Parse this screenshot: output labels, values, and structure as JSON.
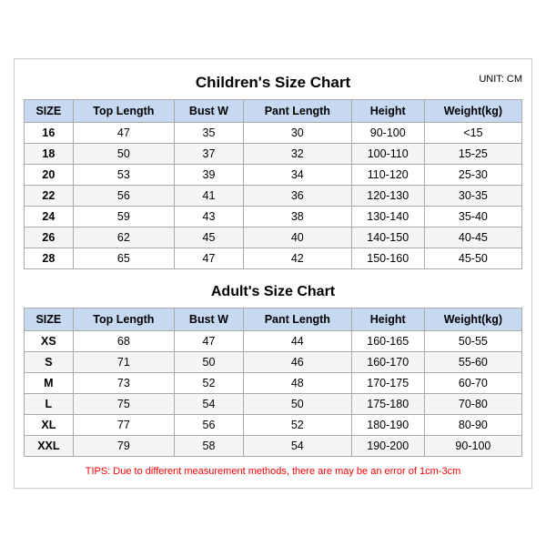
{
  "page": {
    "main_title": "Children's Size Chart",
    "unit_label": "UNIT: CM",
    "children_headers": [
      "SIZE",
      "Top Length",
      "Bust W",
      "Pant Length",
      "Height",
      "Weight(kg)"
    ],
    "children_rows": [
      [
        "16",
        "47",
        "35",
        "30",
        "90-100",
        "<15"
      ],
      [
        "18",
        "50",
        "37",
        "32",
        "100-110",
        "15-25"
      ],
      [
        "20",
        "53",
        "39",
        "34",
        "110-120",
        "25-30"
      ],
      [
        "22",
        "56",
        "41",
        "36",
        "120-130",
        "30-35"
      ],
      [
        "24",
        "59",
        "43",
        "38",
        "130-140",
        "35-40"
      ],
      [
        "26",
        "62",
        "45",
        "40",
        "140-150",
        "40-45"
      ],
      [
        "28",
        "65",
        "47",
        "42",
        "150-160",
        "45-50"
      ]
    ],
    "adult_title": "Adult's Size Chart",
    "adult_headers": [
      "SIZE",
      "Top Length",
      "Bust W",
      "Pant Length",
      "Height",
      "Weight(kg)"
    ],
    "adult_rows": [
      [
        "XS",
        "68",
        "47",
        "44",
        "160-165",
        "50-55"
      ],
      [
        "S",
        "71",
        "50",
        "46",
        "160-170",
        "55-60"
      ],
      [
        "M",
        "73",
        "52",
        "48",
        "170-175",
        "60-70"
      ],
      [
        "L",
        "75",
        "54",
        "50",
        "175-180",
        "70-80"
      ],
      [
        "XL",
        "77",
        "56",
        "52",
        "180-190",
        "80-90"
      ],
      [
        "XXL",
        "79",
        "58",
        "54",
        "190-200",
        "90-100"
      ]
    ],
    "tips": "TIPS: Due to different measurement methods, there are may be an error of 1cm-3cm"
  }
}
